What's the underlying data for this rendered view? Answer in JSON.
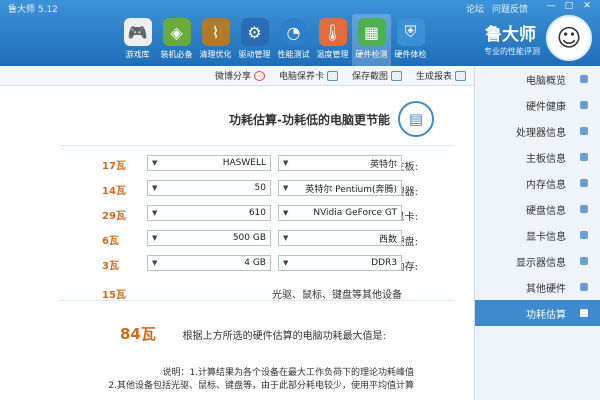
{
  "window": {
    "version": "鲁大师 5.12",
    "links": [
      "论坛",
      "问题反馈"
    ],
    "controls": [
      "—",
      "□",
      "✕"
    ]
  },
  "brand": {
    "name": "鲁大师",
    "slogan": "专业的性能评测"
  },
  "toolbar": [
    {
      "label": "硬件体检",
      "icon": "shield-icon",
      "color": "#3d8fd6"
    },
    {
      "label": "硬件检测",
      "icon": "chip-icon",
      "color": "#4caf50",
      "active": true
    },
    {
      "label": "温度管理",
      "icon": "thermometer-icon",
      "color": "#e06b3d"
    },
    {
      "label": "性能测试",
      "icon": "speedometer-icon",
      "color": "#2c7fc9"
    },
    {
      "label": "驱动管理",
      "icon": "gear-icon",
      "color": "#2a6db5"
    },
    {
      "label": "清理优化",
      "icon": "broom-icon",
      "color": "#b07a2a"
    },
    {
      "label": "装机必备",
      "icon": "cube-icon",
      "color": "#6aaa3a"
    },
    {
      "label": "游戏库",
      "icon": "gamepad-icon",
      "color": "#eeeeee"
    }
  ],
  "subbar": [
    {
      "label": "生成报表"
    },
    {
      "label": "保存截图"
    },
    {
      "label": "电脑保养卡"
    },
    {
      "label": "微博分享"
    }
  ],
  "sidebar": [
    {
      "label": "电脑概览"
    },
    {
      "label": "硬件健康"
    },
    {
      "label": "处理器信息"
    },
    {
      "label": "主板信息"
    },
    {
      "label": "内存信息"
    },
    {
      "label": "硬盘信息"
    },
    {
      "label": "显卡信息"
    },
    {
      "label": "显示器信息"
    },
    {
      "label": "其他硬件"
    },
    {
      "label": "功耗估算",
      "active": true
    }
  ],
  "page": {
    "title": "功耗估算-功耗低的电脑更节能",
    "rows": [
      {
        "label": "主板:",
        "brand": "英特尔",
        "model": "HASWELL",
        "watts": "17瓦"
      },
      {
        "label": "处理器:",
        "brand": "英特尔 Pentium(奔腾)",
        "model": "50",
        "watts": "14瓦"
      },
      {
        "label": "显卡:",
        "brand": "NVidia GeForce GT",
        "model": "610",
        "watts": "29瓦"
      },
      {
        "label": "硬盘:",
        "brand": "西数",
        "model": "500 GB",
        "watts": "6瓦"
      },
      {
        "label": "内存:",
        "brand": "DDR3",
        "model": "4 GB",
        "watts": "3瓦"
      }
    ],
    "other_label": "光驱、鼠标、键盘等其他设备",
    "other_watts": "15瓦",
    "total_label": "根据上方所选的硬件估算的电脑功耗最大值是:",
    "total_value": "84瓦",
    "notes": [
      "说明：1.计算结果为各个设备在最大工作负荷下的理论功耗峰值",
      "2.其他设备包括光驱、鼠标、键盘等，由于此部分耗电较少，使用平均值计算"
    ]
  }
}
